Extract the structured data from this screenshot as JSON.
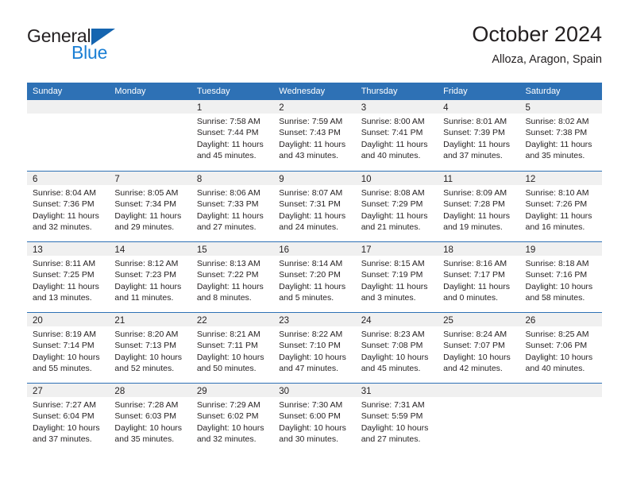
{
  "brand": {
    "name_part1": "General",
    "name_part2": "Blue",
    "triangle_color": "#1565b0",
    "blue_color": "#1b7fd4"
  },
  "header": {
    "title": "October 2024",
    "subtitle": "Alloza, Aragon, Spain"
  },
  "theme": {
    "header_blue": "#2e71b5",
    "day_band_gray": "#f0f0f0",
    "text_color": "#231f20"
  },
  "weekdays": [
    "Sunday",
    "Monday",
    "Tuesday",
    "Wednesday",
    "Thursday",
    "Friday",
    "Saturday"
  ],
  "weeks": [
    [
      {
        "day": "",
        "lines": []
      },
      {
        "day": "",
        "lines": []
      },
      {
        "day": "1",
        "lines": [
          "Sunrise: 7:58 AM",
          "Sunset: 7:44 PM",
          "Daylight: 11 hours",
          "and 45 minutes."
        ]
      },
      {
        "day": "2",
        "lines": [
          "Sunrise: 7:59 AM",
          "Sunset: 7:43 PM",
          "Daylight: 11 hours",
          "and 43 minutes."
        ]
      },
      {
        "day": "3",
        "lines": [
          "Sunrise: 8:00 AM",
          "Sunset: 7:41 PM",
          "Daylight: 11 hours",
          "and 40 minutes."
        ]
      },
      {
        "day": "4",
        "lines": [
          "Sunrise: 8:01 AM",
          "Sunset: 7:39 PM",
          "Daylight: 11 hours",
          "and 37 minutes."
        ]
      },
      {
        "day": "5",
        "lines": [
          "Sunrise: 8:02 AM",
          "Sunset: 7:38 PM",
          "Daylight: 11 hours",
          "and 35 minutes."
        ]
      }
    ],
    [
      {
        "day": "6",
        "lines": [
          "Sunrise: 8:04 AM",
          "Sunset: 7:36 PM",
          "Daylight: 11 hours",
          "and 32 minutes."
        ]
      },
      {
        "day": "7",
        "lines": [
          "Sunrise: 8:05 AM",
          "Sunset: 7:34 PM",
          "Daylight: 11 hours",
          "and 29 minutes."
        ]
      },
      {
        "day": "8",
        "lines": [
          "Sunrise: 8:06 AM",
          "Sunset: 7:33 PM",
          "Daylight: 11 hours",
          "and 27 minutes."
        ]
      },
      {
        "day": "9",
        "lines": [
          "Sunrise: 8:07 AM",
          "Sunset: 7:31 PM",
          "Daylight: 11 hours",
          "and 24 minutes."
        ]
      },
      {
        "day": "10",
        "lines": [
          "Sunrise: 8:08 AM",
          "Sunset: 7:29 PM",
          "Daylight: 11 hours",
          "and 21 minutes."
        ]
      },
      {
        "day": "11",
        "lines": [
          "Sunrise: 8:09 AM",
          "Sunset: 7:28 PM",
          "Daylight: 11 hours",
          "and 19 minutes."
        ]
      },
      {
        "day": "12",
        "lines": [
          "Sunrise: 8:10 AM",
          "Sunset: 7:26 PM",
          "Daylight: 11 hours",
          "and 16 minutes."
        ]
      }
    ],
    [
      {
        "day": "13",
        "lines": [
          "Sunrise: 8:11 AM",
          "Sunset: 7:25 PM",
          "Daylight: 11 hours",
          "and 13 minutes."
        ]
      },
      {
        "day": "14",
        "lines": [
          "Sunrise: 8:12 AM",
          "Sunset: 7:23 PM",
          "Daylight: 11 hours",
          "and 11 minutes."
        ]
      },
      {
        "day": "15",
        "lines": [
          "Sunrise: 8:13 AM",
          "Sunset: 7:22 PM",
          "Daylight: 11 hours",
          "and 8 minutes."
        ]
      },
      {
        "day": "16",
        "lines": [
          "Sunrise: 8:14 AM",
          "Sunset: 7:20 PM",
          "Daylight: 11 hours",
          "and 5 minutes."
        ]
      },
      {
        "day": "17",
        "lines": [
          "Sunrise: 8:15 AM",
          "Sunset: 7:19 PM",
          "Daylight: 11 hours",
          "and 3 minutes."
        ]
      },
      {
        "day": "18",
        "lines": [
          "Sunrise: 8:16 AM",
          "Sunset: 7:17 PM",
          "Daylight: 11 hours",
          "and 0 minutes."
        ]
      },
      {
        "day": "19",
        "lines": [
          "Sunrise: 8:18 AM",
          "Sunset: 7:16 PM",
          "Daylight: 10 hours",
          "and 58 minutes."
        ]
      }
    ],
    [
      {
        "day": "20",
        "lines": [
          "Sunrise: 8:19 AM",
          "Sunset: 7:14 PM",
          "Daylight: 10 hours",
          "and 55 minutes."
        ]
      },
      {
        "day": "21",
        "lines": [
          "Sunrise: 8:20 AM",
          "Sunset: 7:13 PM",
          "Daylight: 10 hours",
          "and 52 minutes."
        ]
      },
      {
        "day": "22",
        "lines": [
          "Sunrise: 8:21 AM",
          "Sunset: 7:11 PM",
          "Daylight: 10 hours",
          "and 50 minutes."
        ]
      },
      {
        "day": "23",
        "lines": [
          "Sunrise: 8:22 AM",
          "Sunset: 7:10 PM",
          "Daylight: 10 hours",
          "and 47 minutes."
        ]
      },
      {
        "day": "24",
        "lines": [
          "Sunrise: 8:23 AM",
          "Sunset: 7:08 PM",
          "Daylight: 10 hours",
          "and 45 minutes."
        ]
      },
      {
        "day": "25",
        "lines": [
          "Sunrise: 8:24 AM",
          "Sunset: 7:07 PM",
          "Daylight: 10 hours",
          "and 42 minutes."
        ]
      },
      {
        "day": "26",
        "lines": [
          "Sunrise: 8:25 AM",
          "Sunset: 7:06 PM",
          "Daylight: 10 hours",
          "and 40 minutes."
        ]
      }
    ],
    [
      {
        "day": "27",
        "lines": [
          "Sunrise: 7:27 AM",
          "Sunset: 6:04 PM",
          "Daylight: 10 hours",
          "and 37 minutes."
        ]
      },
      {
        "day": "28",
        "lines": [
          "Sunrise: 7:28 AM",
          "Sunset: 6:03 PM",
          "Daylight: 10 hours",
          "and 35 minutes."
        ]
      },
      {
        "day": "29",
        "lines": [
          "Sunrise: 7:29 AM",
          "Sunset: 6:02 PM",
          "Daylight: 10 hours",
          "and 32 minutes."
        ]
      },
      {
        "day": "30",
        "lines": [
          "Sunrise: 7:30 AM",
          "Sunset: 6:00 PM",
          "Daylight: 10 hours",
          "and 30 minutes."
        ]
      },
      {
        "day": "31",
        "lines": [
          "Sunrise: 7:31 AM",
          "Sunset: 5:59 PM",
          "Daylight: 10 hours",
          "and 27 minutes."
        ]
      },
      {
        "day": "",
        "lines": []
      },
      {
        "day": "",
        "lines": []
      }
    ]
  ]
}
